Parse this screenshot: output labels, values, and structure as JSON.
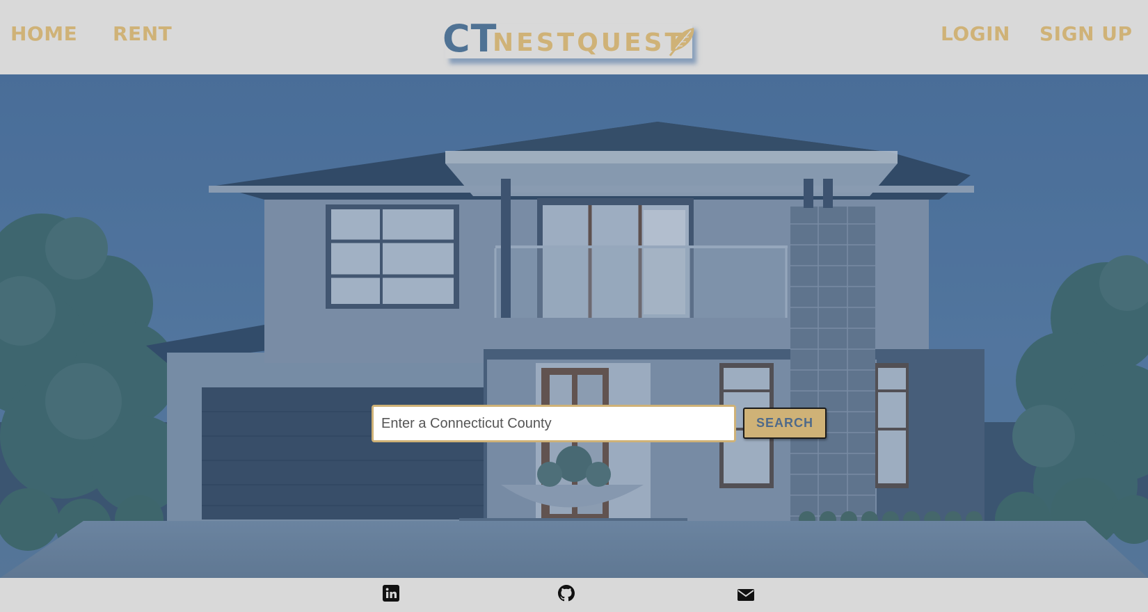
{
  "nav": {
    "home_label": "HOME",
    "rent_label": "RENT",
    "login_label": "LOGIN",
    "signup_label": "SIGN UP"
  },
  "logo": {
    "ct_text": "CT",
    "nestquest_text": "NESTQUEST",
    "icon": "feather-icon"
  },
  "search": {
    "placeholder": "Enter a Connecticut County",
    "value": "",
    "button_label": "SEARCH"
  },
  "footer": {
    "icons": [
      "linkedin-icon",
      "github-icon",
      "envelope-icon"
    ]
  },
  "colors": {
    "accent_gold": "#cfb277",
    "brand_blue": "#4f7294",
    "background_gray": "#d9d9d9",
    "hero_overlay": "#3d5f85"
  }
}
